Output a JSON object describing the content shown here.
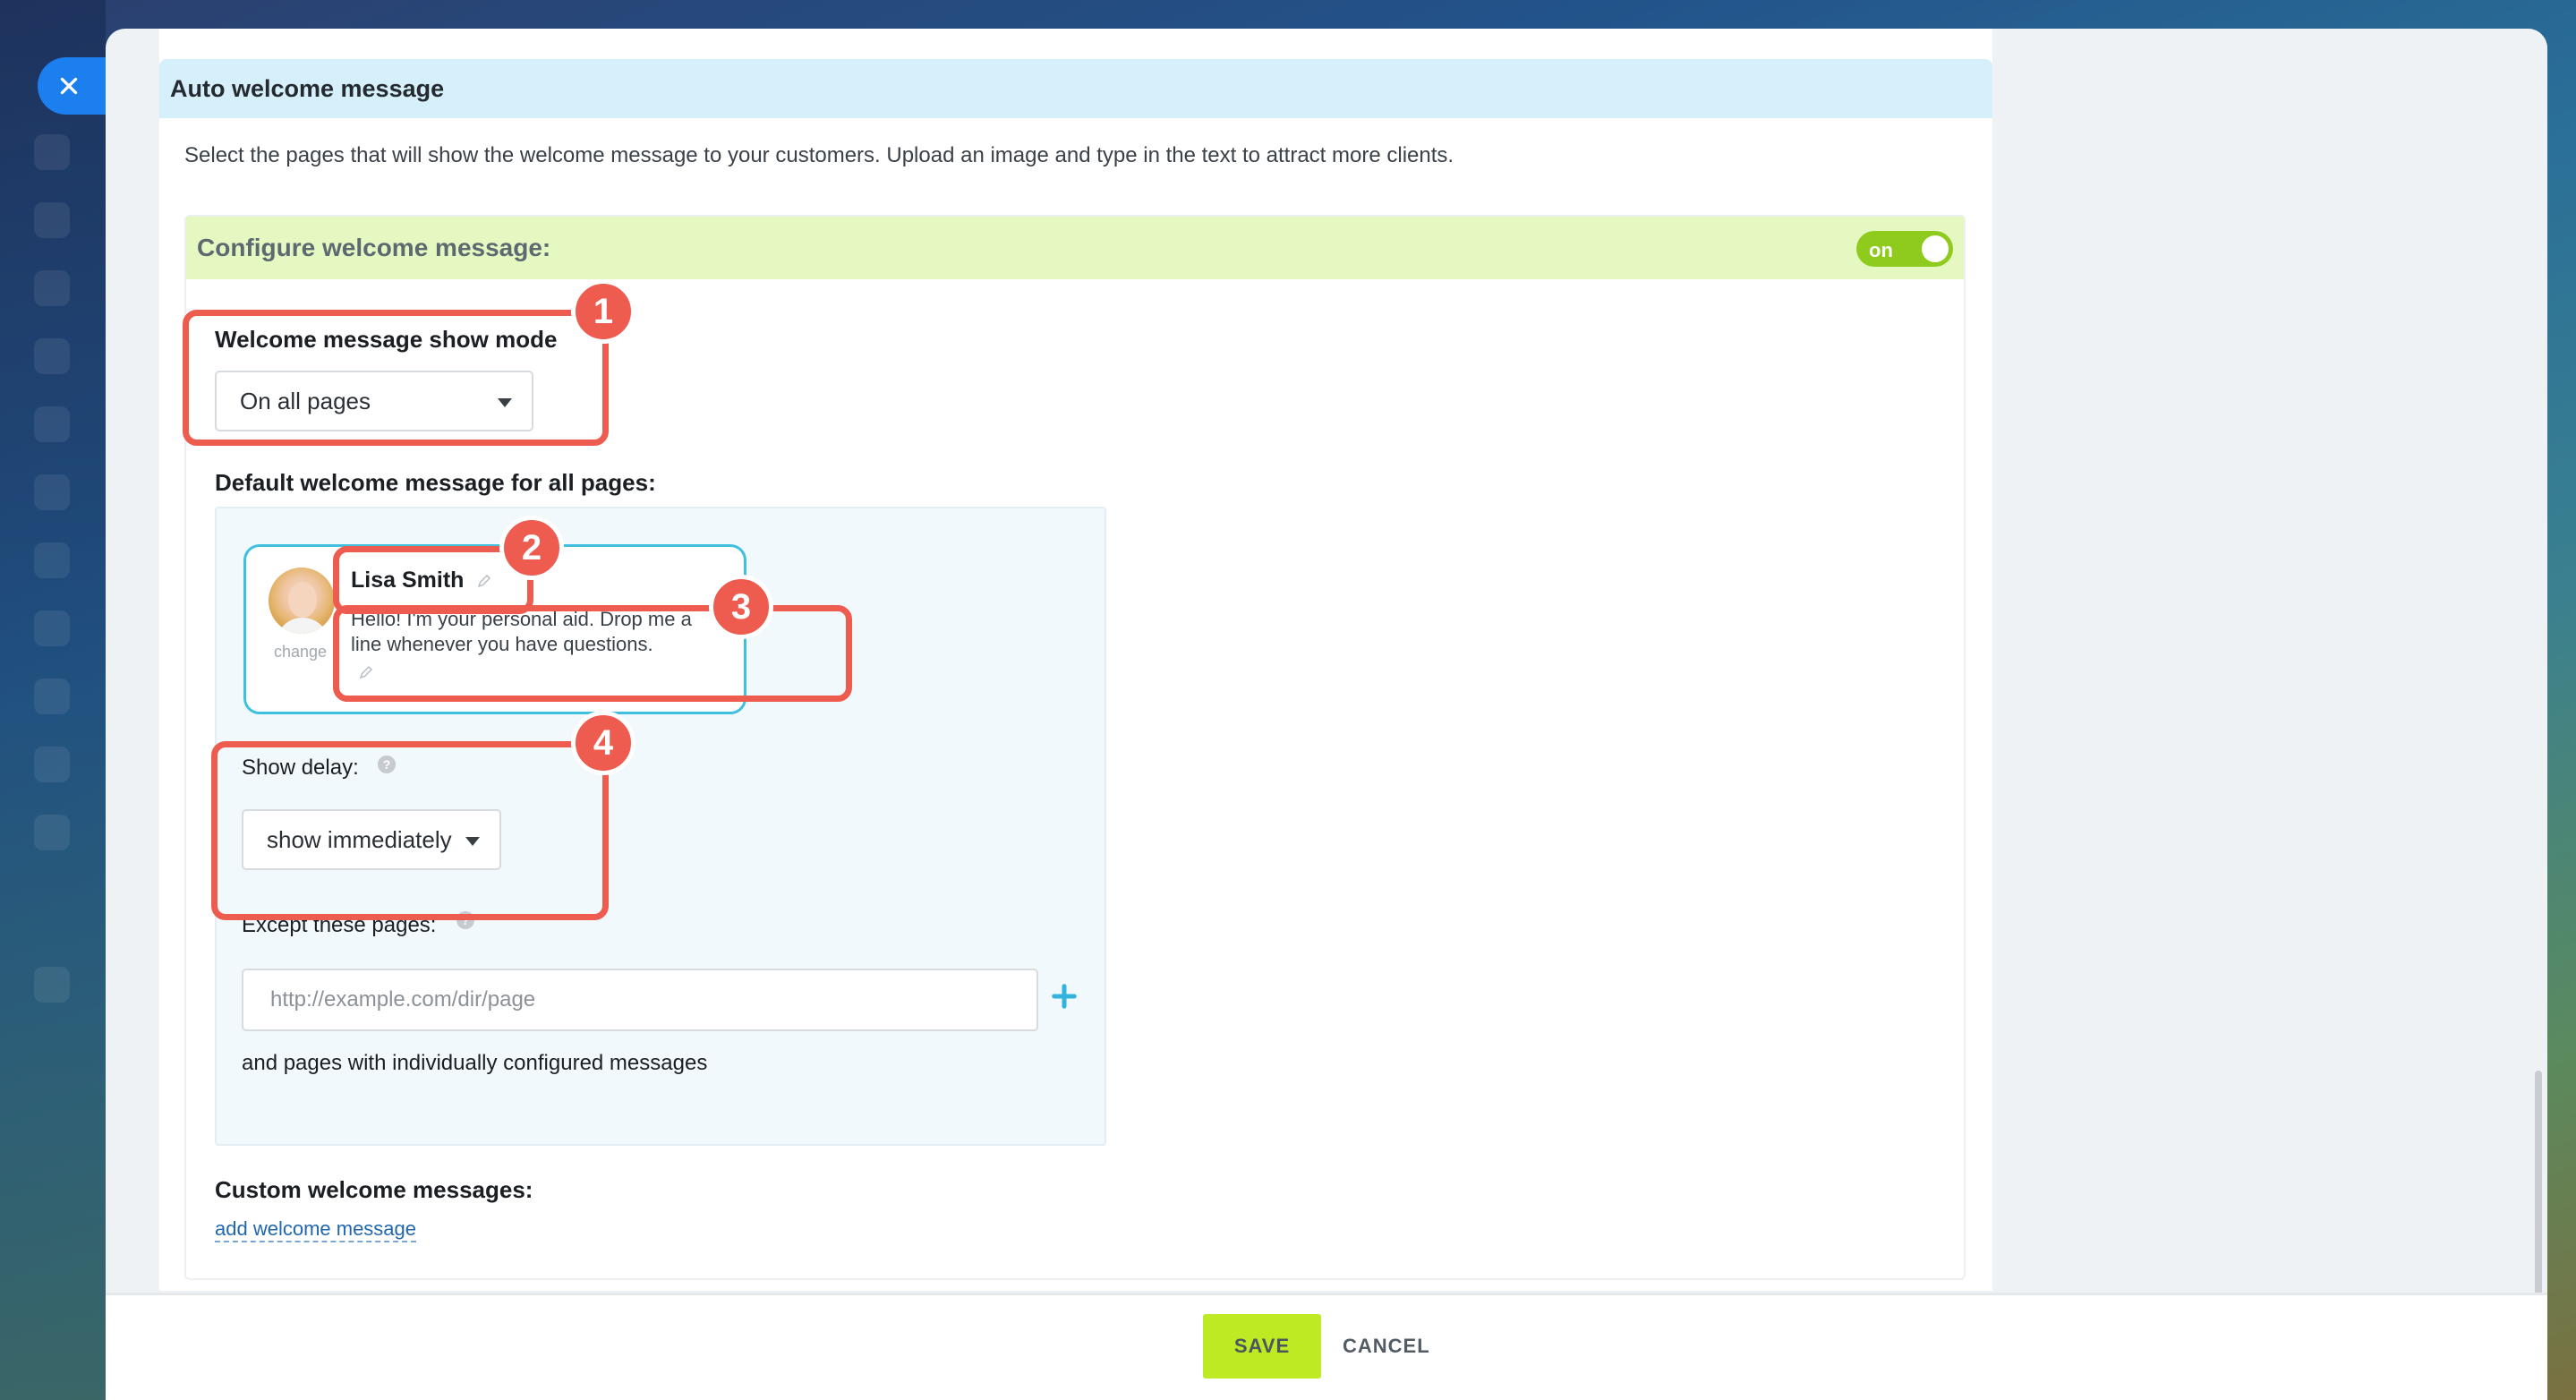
{
  "window": {
    "close_icon": "close-icon"
  },
  "section": {
    "title": "Auto welcome message",
    "description": "Select the pages that will show the welcome message to your customers. Upload an image and type in the text to attract more clients."
  },
  "configure": {
    "title": "Configure welcome message:",
    "toggle_label": "on",
    "toggle_state": true,
    "toggle_color": "#8fcb1d"
  },
  "show_mode": {
    "label": "Welcome message show mode",
    "value": "On all pages"
  },
  "default_message": {
    "label": "Default welcome message for all pages:",
    "agent_name": "Lisa Smith",
    "greeting": "Hello! I'm your personal aid. Drop me a line whenever you have questions.",
    "change_link": "change",
    "avatar_icon": "avatar-photo"
  },
  "show_delay": {
    "label": "Show delay:",
    "value": "show immediately",
    "help_icon": "question-icon"
  },
  "except_pages": {
    "label": "Except these pages:",
    "placeholder": "http://example.com/dir/page",
    "value": "",
    "add_icon": "plus-icon",
    "note": "and pages with individually configured messages"
  },
  "custom_messages": {
    "label": "Custom welcome messages:",
    "add_link": "add welcome message"
  },
  "footer": {
    "save_label": "SAVE",
    "cancel_label": "CANCEL",
    "save_color": "#bdea23"
  },
  "annotations": {
    "badge_1": "1",
    "badge_2": "2",
    "badge_3": "3",
    "badge_4": "4",
    "highlight_color": "#ee5b4f"
  }
}
